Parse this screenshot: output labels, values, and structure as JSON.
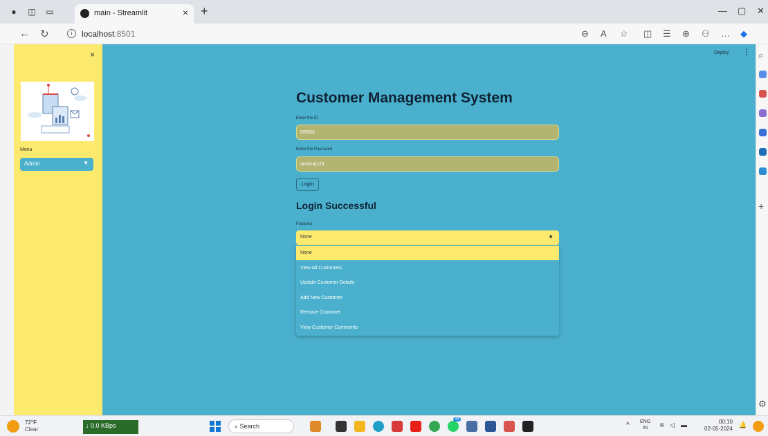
{
  "browser": {
    "tab_title": "main - Streamlit",
    "tab_close": "×",
    "new_tab": "+",
    "url_host": "localhost",
    "url_port": ":8501",
    "info": "i"
  },
  "sidebar": {
    "close": "×",
    "menu_label": "Menu",
    "menu_value": "Admin"
  },
  "header": {
    "deploy": "Deploy",
    "kebab": "⋮"
  },
  "main": {
    "title": "Customer Management System",
    "id_label": "Enter the ID",
    "id_value": "DR001",
    "password_label": "Enter the Password",
    "password_value": "deshraj123",
    "login_button": "Login",
    "success_text": "Login Successful",
    "features_label": "Features",
    "features_value": "None",
    "options": [
      "None",
      "View All Customers",
      "Update Customer Details",
      "Add New Customer",
      "Remove Customer",
      "View Customer Comments"
    ]
  },
  "taskbar": {
    "temp": "72°F",
    "condition": "Clear",
    "net_speed": "↓ 0.0 KBps",
    "search": "Search",
    "lang_top": "ENG",
    "lang_bottom": "IN",
    "time": "00:10",
    "date": "02-05-2024",
    "badge": "34"
  },
  "colors": {
    "sidebar": "#fcea6f",
    "main": "#4ab0cd",
    "input": "#b2b572"
  }
}
